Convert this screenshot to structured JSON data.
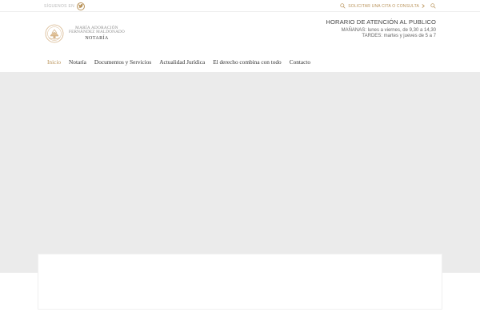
{
  "topbar": {
    "follow_label": "SÍGUENOS EN",
    "follow_icon": "twitter-icon",
    "appointment_label": "SOLICITAR UNA CITA O CONSULTA",
    "appointment_icon": "search-icon",
    "arrow_icon": "chevron-right-icon",
    "search_icon": "search-icon",
    "accent_color": "#b9935a"
  },
  "logo": {
    "line1": "MARÍA ADORACIÓN",
    "line2": "FERNÁNDEZ MALDONADO",
    "line3": "NOTARÍA",
    "seal_icon": "notary-seal-icon"
  },
  "hours": {
    "title": "HORARIO DE ATENCIÓN AL PUBLICO",
    "mornings": "MAÑANAS: lunes a viernes, de 9,30 a 14,30",
    "afternoons": "TARDES: martes y jueves de 5 a 7"
  },
  "nav": {
    "items": [
      {
        "label": "Inicio",
        "active": true
      },
      {
        "label": "Notaría",
        "active": false
      },
      {
        "label": "Documentos y Servicios",
        "active": false
      },
      {
        "label": "Actualidad Jurídica",
        "active": false
      },
      {
        "label": "El derecho combina con todo",
        "active": false
      },
      {
        "label": "Contacto",
        "active": false
      }
    ]
  }
}
